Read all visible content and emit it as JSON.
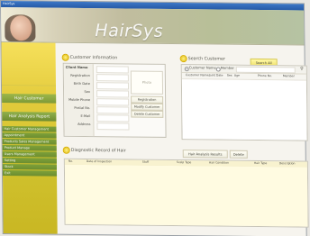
{
  "window": {
    "title": "HairSys"
  },
  "header": {
    "logo_text": "HairSys"
  },
  "sidebar": {
    "customer_button": "Hair Customer",
    "active_button": "Hair Analysis Report",
    "items": [
      "Hair Customer Management",
      "Appointment",
      "Products Sales Management",
      "Product Manage",
      "Users Management",
      "Setting",
      "Stock",
      "Exit"
    ]
  },
  "customer_info": {
    "section_title": "Customer Information",
    "labels": [
      "Client Name",
      "Registration",
      "Birth Date",
      "Sex",
      "Mobile Phone",
      "Postal No.",
      "E-Mail",
      "Address"
    ],
    "photo_label": "Photo",
    "buttons": {
      "registration": "Registration",
      "modify": "Modify Customer",
      "delete": "Delete Customer"
    }
  },
  "search_customer": {
    "section_title": "Search Customer",
    "search_all": "Search All",
    "radio_customer_name": "Customer Name",
    "radio_member": "Member",
    "columns": [
      "Customer Name",
      "Joint Date",
      "Sex",
      "Age",
      "Phone No.",
      "Member"
    ]
  },
  "diagnostic": {
    "section_title": "Diagnostic Record of Hair",
    "buttons": {
      "analysis": "Hair Analysis Results",
      "delete": "Delete"
    },
    "columns": [
      "No.",
      "Date of Inspection",
      "Staff",
      "Scalp Type",
      "Hair Condition",
      "Hair Type",
      "Description"
    ]
  }
}
